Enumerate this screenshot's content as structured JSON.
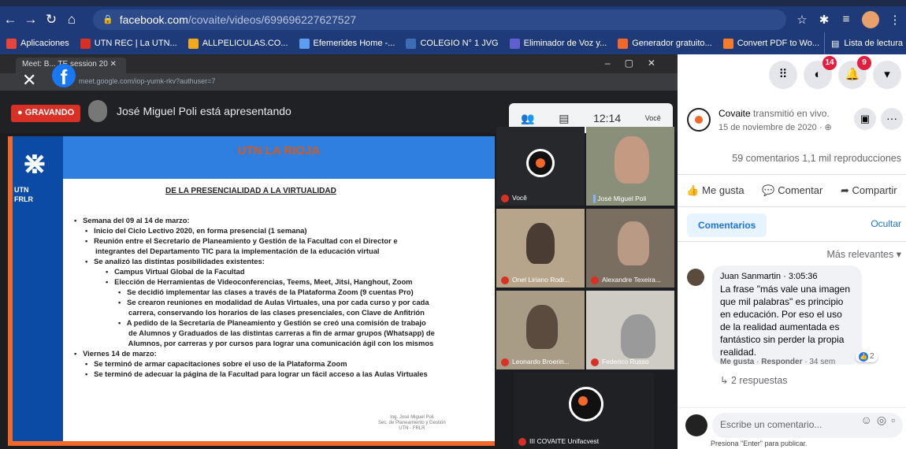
{
  "browser": {
    "url_host": "facebook.com",
    "url_path": "/covaite/videos/699696227627527",
    "bookmarks": [
      {
        "label": "Aplicaciones",
        "color": "#e8443a"
      },
      {
        "label": "UTN REC | La UTN...",
        "color": "#d93025"
      },
      {
        "label": "ALLPELICULAS.CO...",
        "color": "#f4a91d"
      },
      {
        "label": "Efemerides Home -...",
        "color": "#5e9cf0"
      },
      {
        "label": "COLEGIO N° 1 JVG",
        "color": "#3d6db5"
      },
      {
        "label": "Eliminador de Voz y...",
        "color": "#5f5fd0"
      },
      {
        "label": "Generador gratuito...",
        "color": "#f2682a"
      },
      {
        "label": "Convert PDF to Wo...",
        "color": "#f57c2a"
      }
    ],
    "reading_list": "Lista de lectura"
  },
  "meet": {
    "tab_title": "Meet: B... TE session 20",
    "url": "meet.google.com/iop-yumk-rkv?authuser=7",
    "recording": "GRAVANDO",
    "presenting": "José Miguel Poli está apresentando",
    "time": "12:14",
    "you_label": "Você",
    "slide": {
      "title": "UTN LA RIOJA",
      "org": "UTN\nFRLR",
      "subtitle": "DE LA PRESENCIALIDAD A LA VIRTUALIDAD",
      "lines": [
        {
          "lvl": 1,
          "text": "•   Semana del 09 al 14 de marzo:"
        },
        {
          "lvl": 2,
          "text": "•   Inicio del Ciclo Lectivo 2020, en forma presencial (1 semana)"
        },
        {
          "lvl": 2,
          "text": "•   Reunión entre el Secretario de Planeamiento y Gestión de la Facultad con el Director e"
        },
        {
          "lvl": 2,
          "text": "     integrantes del Departamento TIC para la implementación de la educación virtual"
        },
        {
          "lvl": 2,
          "text": "•   Se analizó las distintas posibilidades existentes:"
        },
        {
          "lvl": 3,
          "text": "•   Campus Virtual Global de la Facultad"
        },
        {
          "lvl": 3,
          "text": "•   Elección de Herramientas de Videoconferencias, Teems, Meet, Jitsi, Hanghout, Zoom"
        },
        {
          "lvl": 4,
          "text": "•   Se decidió implementar las clases a través de la Plataforma Zoom (9 cuentas Pro)"
        },
        {
          "lvl": 4,
          "text": "•   Se crearon reuniones en modalidad de Aulas Virtuales, una por cada curso y por cada"
        },
        {
          "lvl": 4,
          "text": "     carrera, conservando los horarios de las clases presenciales, con Clave de Anfitrión"
        },
        {
          "lvl": 4,
          "text": "•   A pedido de la Secretaría de Planeamiento y Gestión se creó una comisión de trabajo"
        },
        {
          "lvl": 4,
          "text": "     de Alumnos y Graduados de las distintas carreras a fin de armar grupos (Whatsapp) de"
        },
        {
          "lvl": 4,
          "text": "     Alumnos, por carreras y por cursos para lograr una comunicación ágil con los mismos"
        },
        {
          "lvl": 1,
          "text": "•   Viernes 14 de marzo:"
        },
        {
          "lvl": 2,
          "text": "•   Se terminó de armar capacitaciones sobre el uso de la Plataforma Zoom"
        },
        {
          "lvl": 2,
          "text": "•   Se terminó de adecuar la página de la Facultad para lograr un fácil acceso a las Aulas Virtuales"
        }
      ],
      "signature": "Ing. José Miguel Poli\nSec. de Planeamiento y Gestión\nUTN - FRLR"
    },
    "participants": [
      {
        "name": "Você"
      },
      {
        "name": "José Miguel Poli"
      },
      {
        "name": "Onel Liriano Rodr..."
      },
      {
        "name": "Alexandre Texeira..."
      },
      {
        "name": "Leonardo Broerin..."
      },
      {
        "name": "Federico Russo"
      },
      {
        "name": "III COVAITE Unifacvest"
      }
    ]
  },
  "facebook": {
    "badges": {
      "messenger": "14",
      "notifications": "9"
    },
    "post": {
      "page": "Covaite",
      "action": " transmitió en vivo.",
      "date": "15 de noviembre de 2020 · ⊕",
      "counts": "59 comentarios  1,1 mil reproducciones"
    },
    "actions": {
      "like": "Me gusta",
      "comment": "Comentar",
      "share": "Compartir"
    },
    "comments_tab": "Comentarios",
    "hide": "Ocultar",
    "sort": "Más relevantes ▾",
    "comment": {
      "author": "Juan Sanmartin",
      "time": "3:05:36",
      "text": "La frase \"más vale una imagen que mil palabras\" es principio en educación. Por eso el uso de la realidad aumentada es fantástico sin perder la propia realidad.",
      "reactions": "2",
      "like": "Me gusta",
      "reply": "Responder",
      "age": "34 sem",
      "replies": "2 respuestas"
    },
    "write": {
      "placeholder": "Escribe un comentario...",
      "hint": "Presiona \"Enter\" para publicar."
    }
  }
}
